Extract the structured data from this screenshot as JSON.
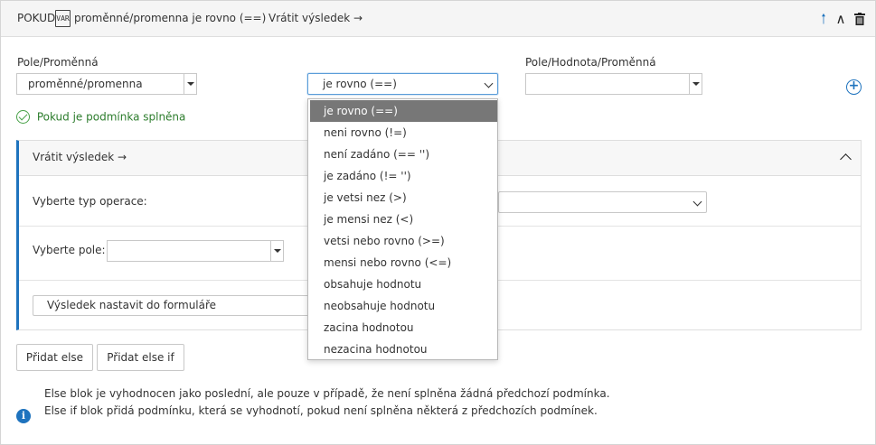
{
  "header": {
    "prefix": "POKUD",
    "var_icon_text": "VAR",
    "condition": "proměnné/promenna je rovno (==)",
    "action": "Vrátit výsledek →",
    "icons": [
      "arrow-up-icon",
      "chevron-up-icon",
      "trash-icon"
    ]
  },
  "condition_row": {
    "field_label": "Pole/Proměnná",
    "field_value": "proměnné/promenna",
    "operator_value": "je rovno (==)",
    "value_label": "Pole/Hodnota/Proměnná",
    "value_value": "",
    "add_icon": "plus-circle-icon"
  },
  "status": {
    "text": "Pokud je podmínka splněna",
    "icon": "check-circle-icon"
  },
  "panel": {
    "title": "Vrátit výsledek →",
    "operation_type_label": "Vyberte typ operace:",
    "operation_type_value": "",
    "field_select_label": "Vyberte pole:",
    "field_select_value": "",
    "result_button": "Výsledek nastavit do formuláře"
  },
  "buttons": {
    "add_else": "Přidat else",
    "add_else_if": "Přidat else if"
  },
  "info": {
    "line1": "Else blok je vyhodnocen jako poslední, ale pouze v případě, že není splněna žádná předchozí podmínka.",
    "line2": "Else if blok přidá podmínku, která se vyhodnotí, pokud není splněna některá z předchozích podmínek.",
    "icon": "info-icon"
  },
  "dropdown": {
    "selected_index": 0,
    "options": [
      "je rovno (==)",
      "neni rovno (!=)",
      "není zadáno (== '')",
      "je zadáno (!= '')",
      "je vetsi nez (>)",
      "je mensi nez (<)",
      "vetsi nebo rovno (>=)",
      "mensi nebo rovno (<=)",
      "obsahuje hodnotu",
      "neobsahuje hodnotu",
      "zacina hodnotou",
      "nezacina hodnotou"
    ]
  },
  "colors": {
    "accent": "#1e73be",
    "success": "#46a046",
    "selected_option_bg": "#777777"
  }
}
